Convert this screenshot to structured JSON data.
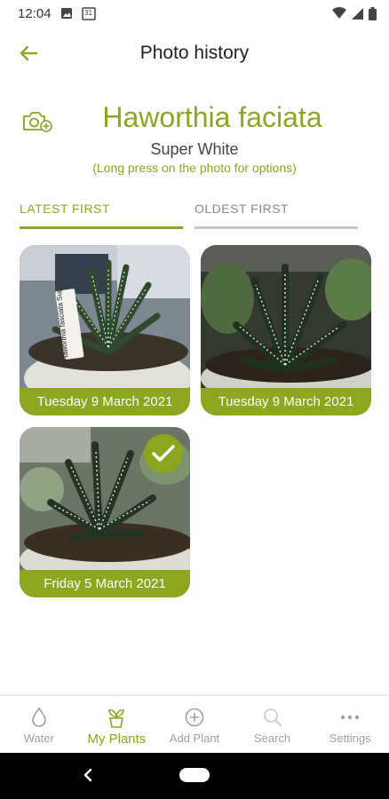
{
  "status_bar": {
    "time": "12:04",
    "calendar_day": "31"
  },
  "app_bar": {
    "title": "Photo history",
    "back_icon": "arrow-left-icon"
  },
  "plant": {
    "name": "Haworthia faciata",
    "variety": "Super White",
    "hint": "(Long press on the photo for options)",
    "camera_icon": "camera-add-icon"
  },
  "sort_tabs": [
    {
      "label": "LATEST FIRST",
      "selected": true
    },
    {
      "label": "OLDEST FIRST",
      "selected": false
    }
  ],
  "photos": [
    {
      "date": "Tuesday 9 March 2021",
      "tag_text": "Haworthia fasciata Super White",
      "selected": false
    },
    {
      "date": "Tuesday 9 March 2021",
      "selected": false
    },
    {
      "date": "Friday 5 March 2021",
      "selected": true
    }
  ],
  "bottom_nav": [
    {
      "label": "Water",
      "icon": "water-drop-icon",
      "active": false
    },
    {
      "label": "My Plants",
      "icon": "plant-pot-icon",
      "active": true
    },
    {
      "label": "Add Plant",
      "icon": "add-circle-icon",
      "active": false
    },
    {
      "label": "Search",
      "icon": "search-icon",
      "active": false
    },
    {
      "label": "Settings",
      "icon": "more-dots-icon",
      "active": false
    }
  ],
  "colors": {
    "accent": "#8ca61f",
    "inactive": "#a0a0a0"
  }
}
